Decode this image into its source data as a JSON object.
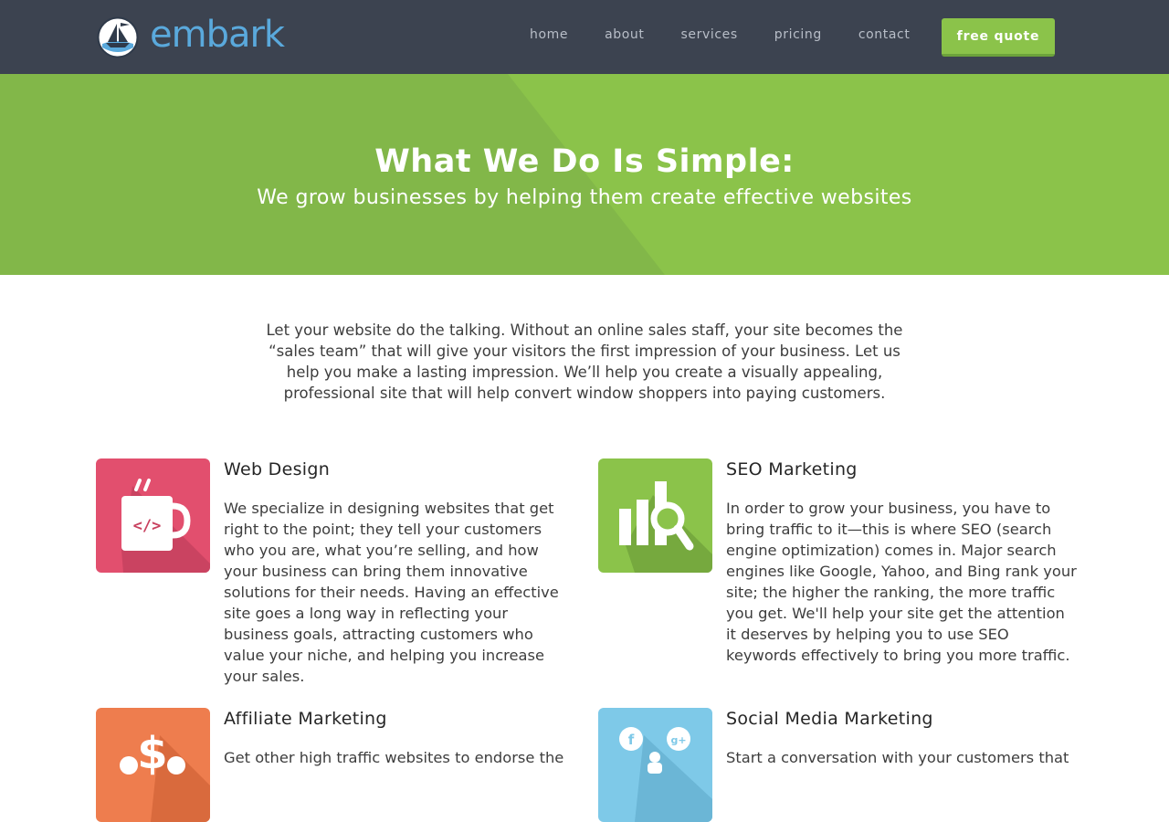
{
  "brand": {
    "name": "embark",
    "logo_icon": "ship-icon",
    "colors": {
      "accent": "#5aa9dc",
      "green": "#8bc34a",
      "nav_bg": "#3c4350"
    }
  },
  "nav": {
    "items": [
      {
        "label": "home"
      },
      {
        "label": "about"
      },
      {
        "label": "services"
      },
      {
        "label": "pricing"
      },
      {
        "label": "contact"
      }
    ],
    "cta_label": "free quote",
    "cta_color": "#8bc34a"
  },
  "hero": {
    "title": "What We Do Is Simple:",
    "subtitle": "We grow businesses by helping them create effective websites"
  },
  "intro": {
    "text": "Let your website do the talking. Without an online sales staff, your site becomes the “sales team” that will give your visitors the first impression of your business. Let us help you make a lasting impression. We’ll help you create a visually appealing, professional site that will help convert window shoppers into paying customers."
  },
  "services": [
    {
      "title": "Web Design",
      "icon": "coffee-code-icon",
      "color": "#e24f6e",
      "text": "We specialize in designing websites that get right to the point; they tell your customers who you are, what you’re selling, and how your business can bring them innovative solutions for their needs. Having an effective site  goes a long way in reflecting your business goals, attracting customers who value your niche, and helping you increase your sales."
    },
    {
      "title": "SEO Marketing",
      "icon": "chart-magnifier-icon",
      "color": "#8bc34a",
      "text": "In order to grow your business, you have to bring traffic to it—this is where SEO (search engine optimization) comes in. Major search engines like Google, Yahoo, and Bing rank your site; the higher the ranking, the more traffic you get. We'll help your site get the attention it deserves by helping you to use SEO keywords effectively to bring you more traffic."
    },
    {
      "title": "Affiliate Marketing",
      "icon": "dollar-network-icon",
      "color": "#ee7d4e",
      "text": "Get other high traffic websites to endorse the"
    },
    {
      "title": "Social Media Marketing",
      "icon": "social-chat-icon",
      "color": "#7ec9e8",
      "text": "Start a conversation with your customers that"
    }
  ]
}
